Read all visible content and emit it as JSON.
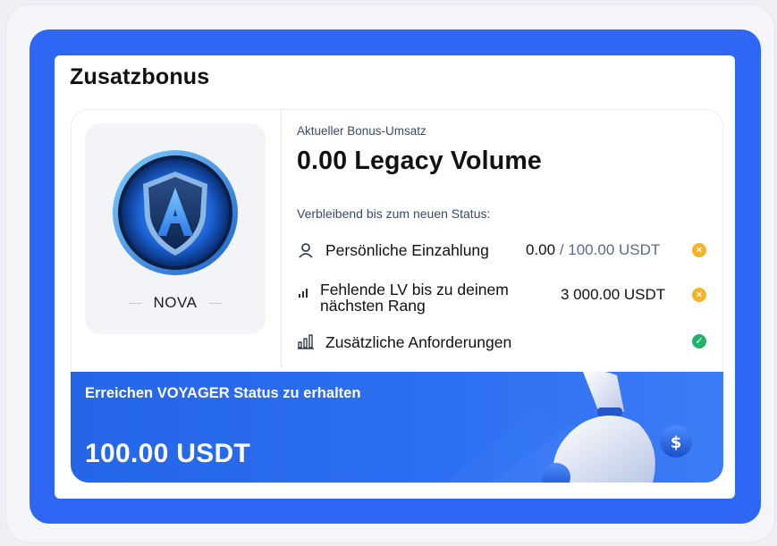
{
  "title": "Zusatzbonus",
  "rank": {
    "name": "NOVA",
    "icon_letter": "A"
  },
  "current": {
    "label": "Aktueller Bonus-Umsatz",
    "value": "0.00 Legacy Volume"
  },
  "remaining_label": "Verbleibend bis zum neuen Status:",
  "requirements": [
    {
      "icon": "user-icon",
      "label": "Persönliche Einzahlung",
      "value_current": "0.00",
      "value_target": "/ 100.00 USDT",
      "status": "pending"
    },
    {
      "icon": "bar-chart-icon",
      "label_line1": "Fehlende LV bis zu deinem",
      "label_line2": "nächsten Rang",
      "value": "3 000.00 USDT",
      "status": "pending"
    },
    {
      "icon": "bar-chart-icon",
      "label": "Zusätzliche Anforderungen",
      "status": "complete"
    }
  ],
  "banner": {
    "text": "Erreichen VOYAGER Status zu erhalten",
    "amount": "100.00 USDT"
  },
  "colors": {
    "frame": "#2f67f5",
    "banner": "#2566e8",
    "warning": "#f3b42a",
    "success": "#23b26d"
  }
}
